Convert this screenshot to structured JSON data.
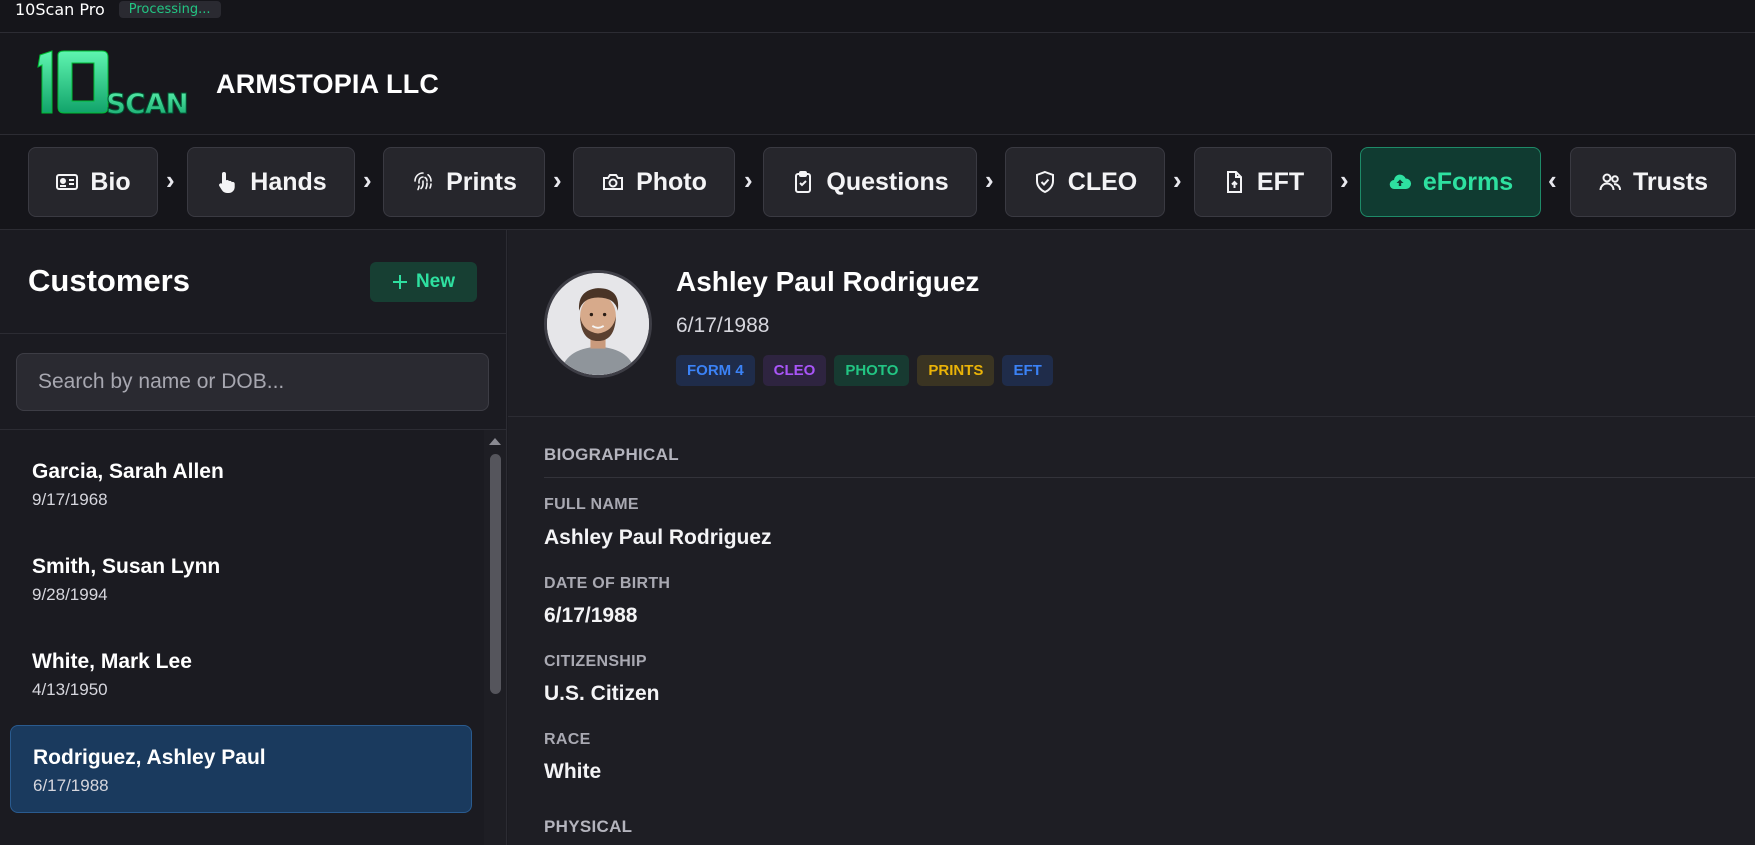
{
  "titlebar": {
    "app_title": "10Scan Pro",
    "status": "Processing..."
  },
  "header": {
    "logo_alt": "10SCAN",
    "company": "ARMSTOPIA LLC"
  },
  "nav": {
    "items": [
      {
        "label": "Bio",
        "icon": "id-card-icon"
      },
      {
        "label": "Hands",
        "icon": "hand-pointer-icon"
      },
      {
        "label": "Prints",
        "icon": "fingerprint-icon"
      },
      {
        "label": "Photo",
        "icon": "camera-icon"
      },
      {
        "label": "Questions",
        "icon": "clipboard-check-icon"
      },
      {
        "label": "CLEO",
        "icon": "shield-check-icon"
      },
      {
        "label": "EFT",
        "icon": "file-upload-icon"
      },
      {
        "label": "eForms",
        "icon": "cloud-upload-icon",
        "active": true
      },
      {
        "label": "Trusts",
        "icon": "users-icon"
      }
    ],
    "separators": [
      "›",
      "›",
      "›",
      "›",
      "›",
      "›",
      "›",
      "‹"
    ]
  },
  "sidebar": {
    "title": "Customers",
    "new_label": "New",
    "search_placeholder": "Search by name or DOB...",
    "customers": [
      {
        "name": "Garcia, Sarah Allen",
        "dob": "9/17/1968"
      },
      {
        "name": "Smith, Susan Lynn",
        "dob": "9/28/1994"
      },
      {
        "name": "White, Mark Lee",
        "dob": "4/13/1950"
      },
      {
        "name": "Rodriguez, Ashley Paul",
        "dob": "6/17/1988",
        "selected": true
      }
    ]
  },
  "profile": {
    "name": "Ashley Paul Rodriguez",
    "dob": "6/17/1988",
    "badges": [
      {
        "label": "FORM 4",
        "color": "#3b82f6",
        "bg": "#1f2c4a"
      },
      {
        "label": "CLEO",
        "color": "#a855f7",
        "bg": "#2e2440"
      },
      {
        "label": "PHOTO",
        "color": "#22c583",
        "bg": "#173a31"
      },
      {
        "label": "PRINTS",
        "color": "#eab308",
        "bg": "#3a3422"
      },
      {
        "label": "EFT",
        "color": "#3b82f6",
        "bg": "#1f2c4a"
      }
    ]
  },
  "details": {
    "biographical_title": "BIOGRAPHICAL",
    "fields": [
      {
        "label": "FULL NAME",
        "value": "Ashley Paul Rodriguez"
      },
      {
        "label": "DATE OF BIRTH",
        "value": "6/17/1988"
      },
      {
        "label": "CITIZENSHIP",
        "value": "U.S. Citizen"
      },
      {
        "label": "RACE",
        "value": "White"
      }
    ],
    "physical_title": "PHYSICAL"
  },
  "colors": {
    "accent": "#2ee0a0",
    "selected_row": "#1a3a5e",
    "background": "#1b1b21"
  }
}
